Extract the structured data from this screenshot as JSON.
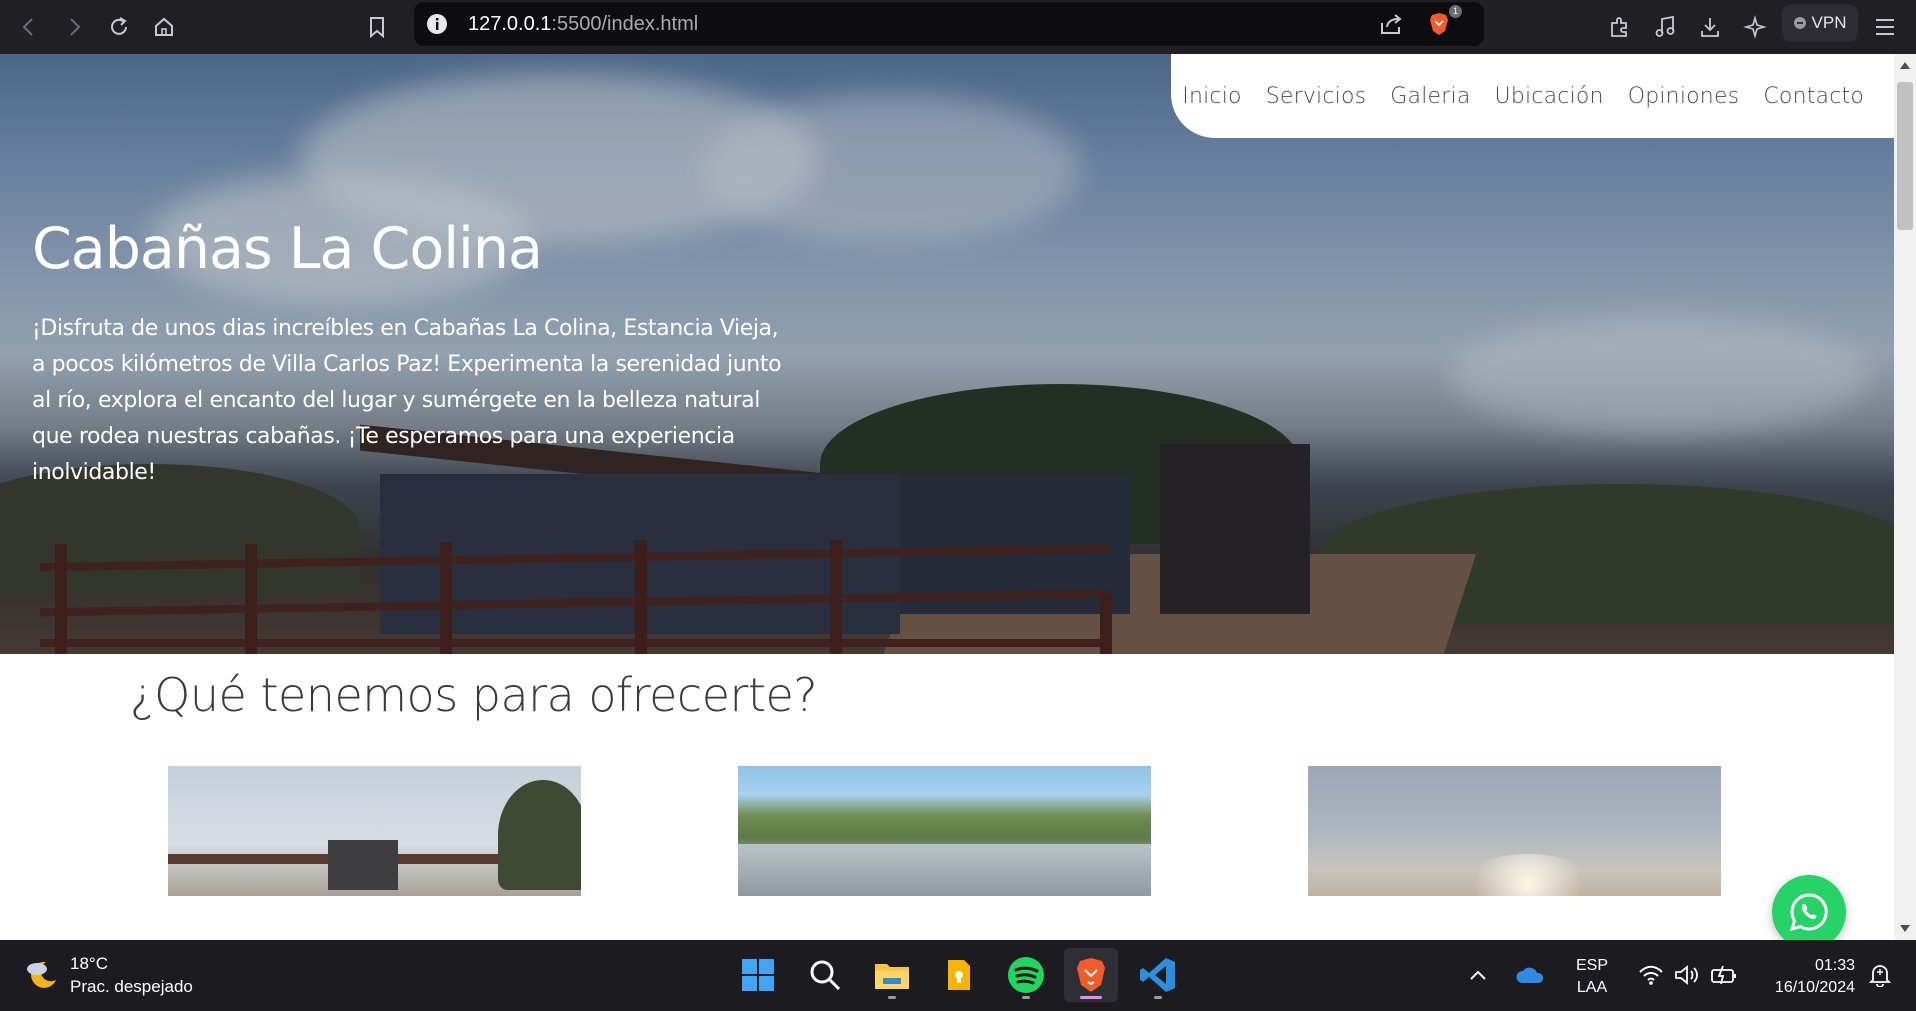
{
  "browser": {
    "url_host": "127.0.0.1",
    "url_path": ":5500/index.html",
    "brave_badge_count": "1",
    "vpn_label": "VPN"
  },
  "nav": {
    "items": [
      "Inicio",
      "Servicios",
      "Galeria",
      "Ubicación",
      "Opiniones",
      "Contacto"
    ]
  },
  "hero": {
    "title": "Cabañas La Colina",
    "description": "¡Disfruta de unos dias increíbles en Cabañas La Colina, Estancia Vieja, a pocos kilómetros de Villa Carlos Paz! Experimenta la serenidad junto al río, explora el encanto del lugar y sumérgete en la belleza natural que rodea nuestras cabañas. ¡Te esperamos para una experiencia inolvidable!"
  },
  "offer": {
    "title": "¿Qué tenemos para ofrecerte?"
  },
  "taskbar": {
    "weather_temp": "18°C",
    "weather_desc": "Prac. despejado",
    "lang_line1": "ESP",
    "lang_line2": "LAA",
    "time": "01:33",
    "date": "16/10/2024"
  },
  "colors": {
    "whatsapp": "#25d366",
    "taskbar": "#1c1c20",
    "browser_bar": "#1f1f24"
  }
}
